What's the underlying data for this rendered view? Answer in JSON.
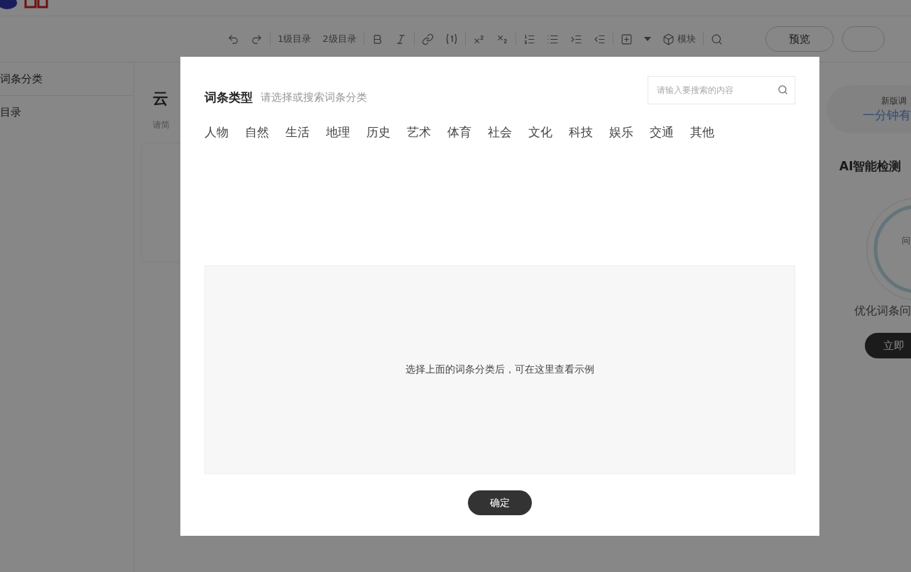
{
  "editor": {
    "toolbar": [
      {
        "kind": "undo"
      },
      {
        "kind": "redo"
      },
      {
        "kind": "divider"
      },
      {
        "kind": "text",
        "label": "1级目录"
      },
      {
        "kind": "text",
        "label": "2级目录"
      },
      {
        "kind": "divider"
      },
      {
        "kind": "bold"
      },
      {
        "kind": "italic"
      },
      {
        "kind": "divider"
      },
      {
        "kind": "link"
      },
      {
        "kind": "footnote"
      },
      {
        "kind": "divider"
      },
      {
        "kind": "superscript"
      },
      {
        "kind": "subscript"
      },
      {
        "kind": "divider"
      },
      {
        "kind": "ordered"
      },
      {
        "kind": "bullets"
      },
      {
        "kind": "indent"
      },
      {
        "kind": "outdent"
      },
      {
        "kind": "divider"
      },
      {
        "kind": "insert"
      },
      {
        "kind": "caret"
      },
      {
        "kind": "module",
        "label": "模块"
      },
      {
        "kind": "divider"
      },
      {
        "kind": "search"
      }
    ],
    "buttons": [
      "预览"
    ],
    "sidebar": {
      "items": [
        "词条分类",
        "目录"
      ]
    },
    "main": {
      "title": "云",
      "hint": "请简"
    },
    "right_panel": {
      "survey_label": "新版调",
      "survey_link": "一分钟有",
      "ai_title": "AI智能检测",
      "ring_label": "问",
      "ai_text": "优化词条问",
      "ai_button": "立即"
    }
  },
  "dialog": {
    "title": "词条类型",
    "subtitle": "请选择或搜索词条分类",
    "search": {
      "placeholder": "请输入要搜索的内容"
    },
    "categories": [
      {
        "label": "人物",
        "selected": false
      },
      {
        "label": "自然",
        "selected": false
      },
      {
        "label": "生活",
        "selected": false
      },
      {
        "label": "地理",
        "selected": false
      },
      {
        "label": "历史",
        "selected": false
      },
      {
        "label": "艺术",
        "selected": false
      },
      {
        "label": "体育",
        "selected": false
      },
      {
        "label": "社会",
        "selected": false
      },
      {
        "label": "文化",
        "selected": false
      },
      {
        "label": "科技",
        "selected": false
      },
      {
        "label": "娱乐",
        "selected": false
      },
      {
        "label": "交通",
        "selected": false
      },
      {
        "label": "其他",
        "selected": false
      }
    ],
    "example_hint": "选择上面的词条分类后，可在这里查看示例",
    "confirm": "确定"
  }
}
